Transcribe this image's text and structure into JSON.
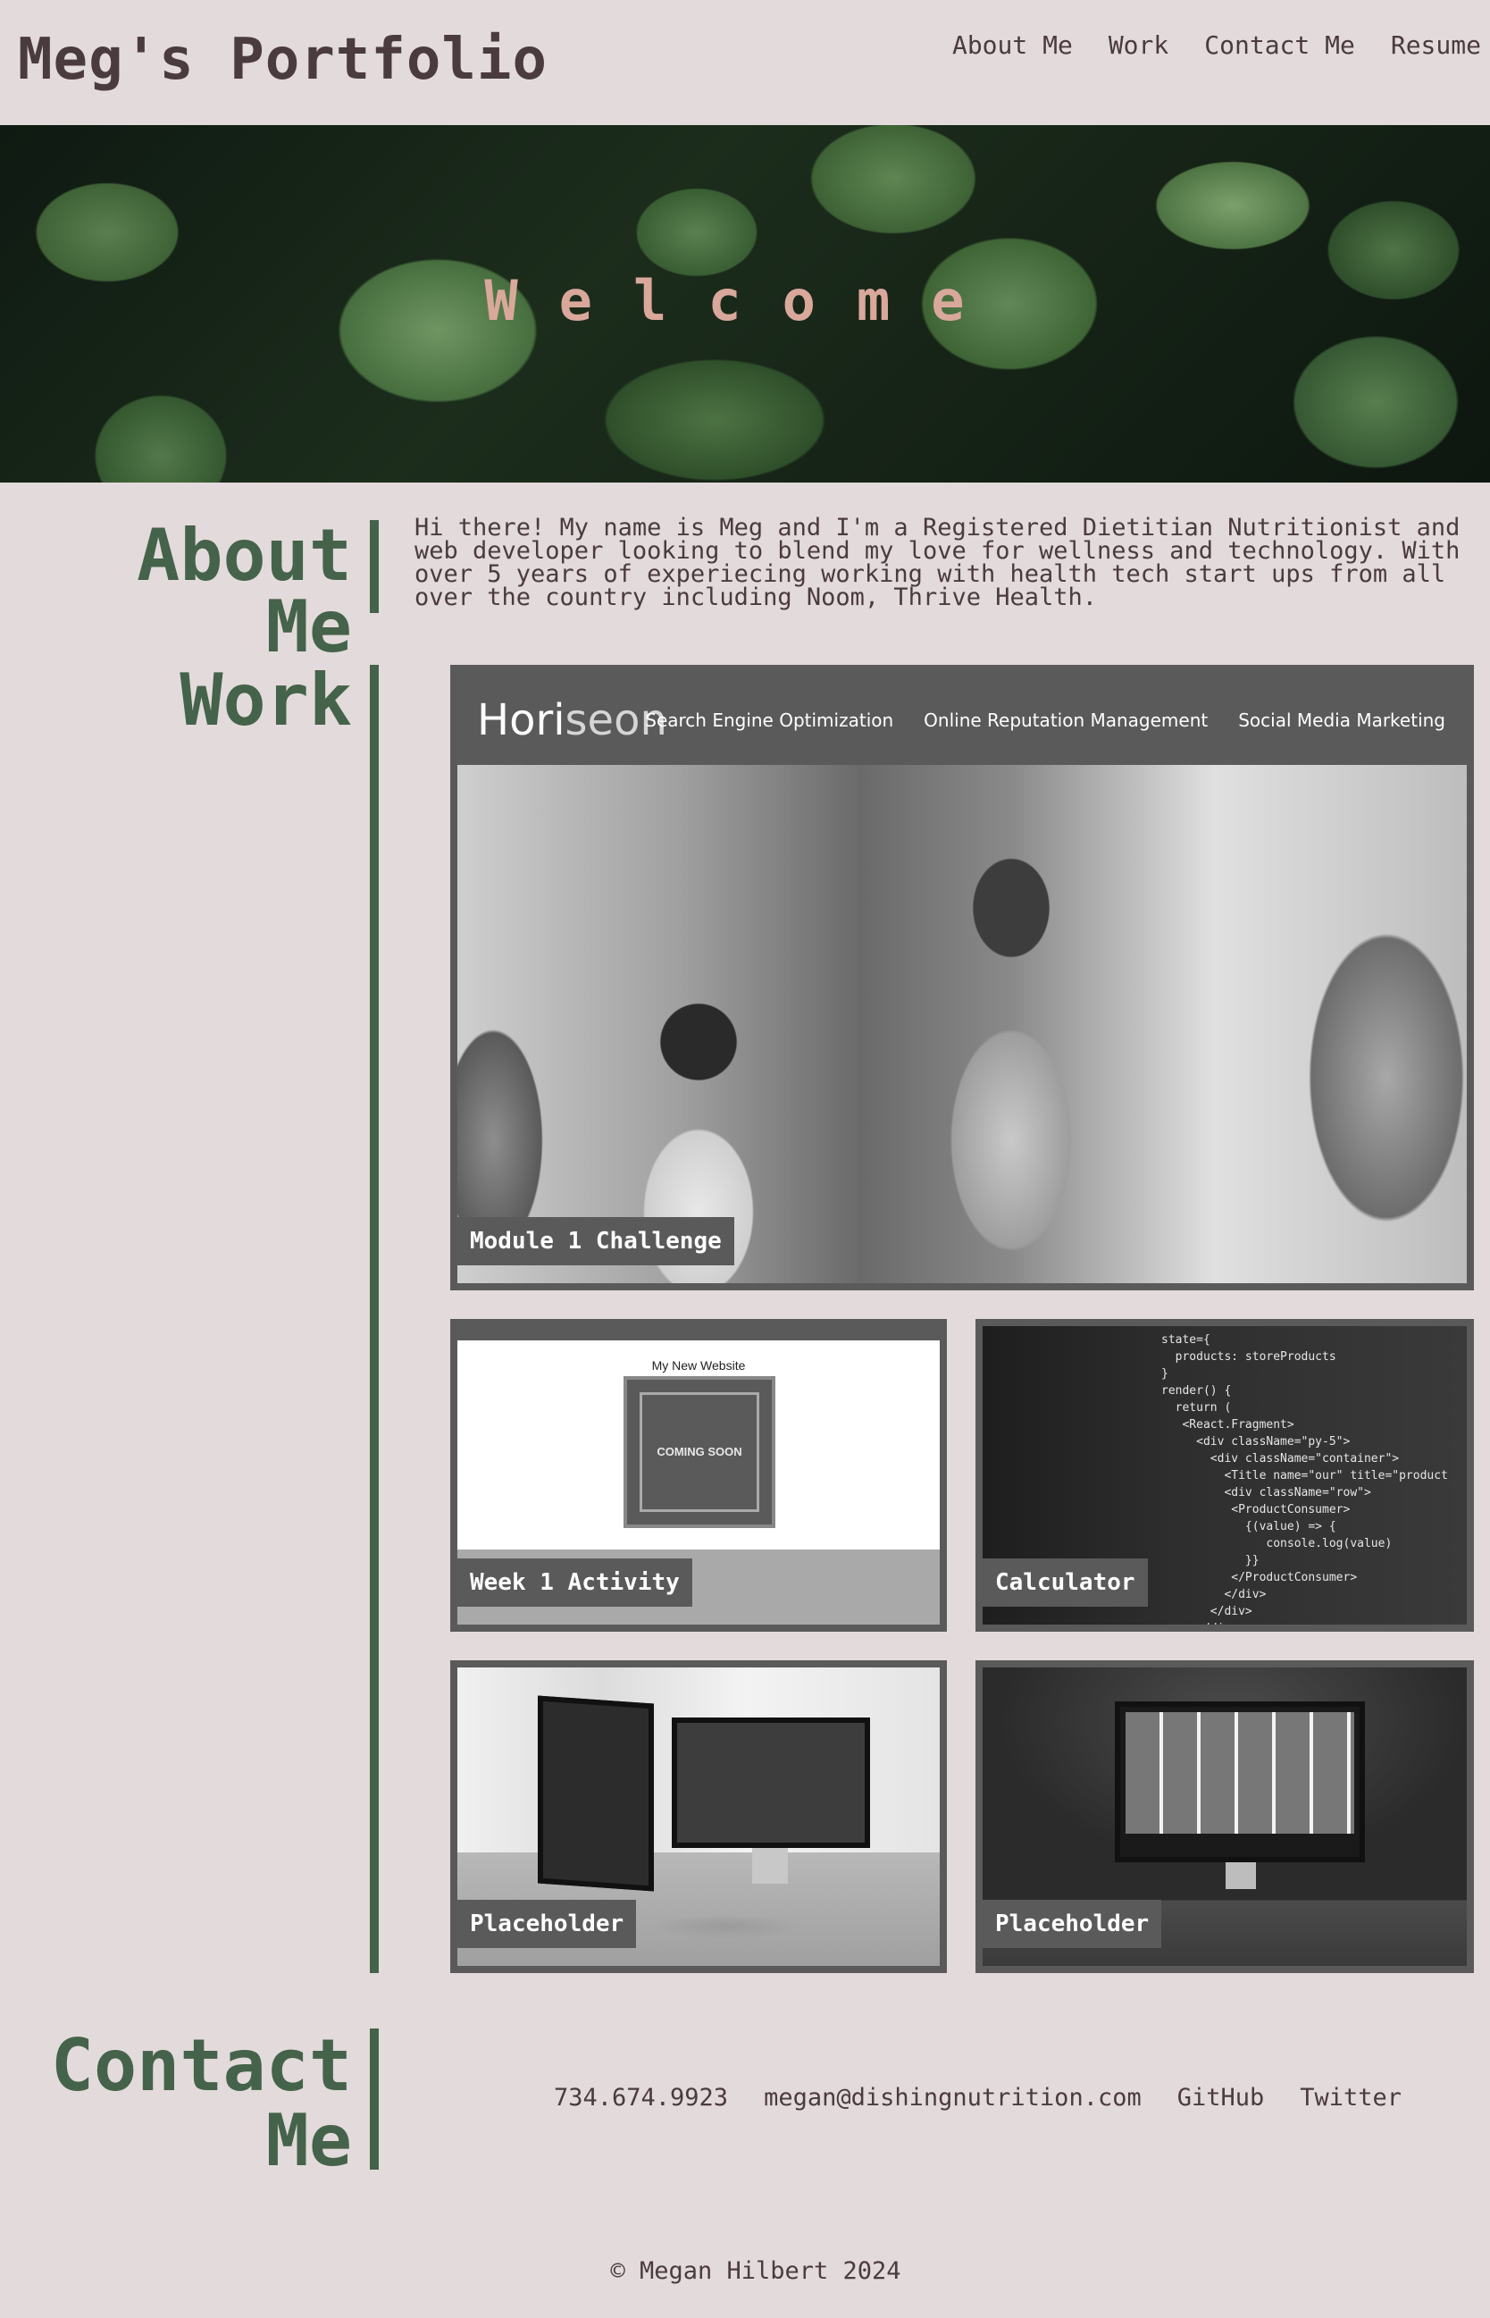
{
  "header": {
    "title": "Meg's Portfolio",
    "nav": [
      "About Me",
      "Work",
      "Contact Me",
      "Resume"
    ]
  },
  "hero": {
    "text": "Welcome"
  },
  "about": {
    "heading": "About Me",
    "text": "Hi there! My name is Meg and I'm a Registered Dietitian Nutritionist and web developer looking to blend my love for wellness and technology. With over 5 years of experiecing working with health tech start ups from all over the country including Noom, Thrive Health."
  },
  "work": {
    "heading": "Work",
    "projects": [
      {
        "label": "Module 1 Challenge",
        "preview": {
          "logo_bold": "Hori",
          "logo_light": "seon",
          "nav": [
            "Search Engine Optimization",
            "Online Reputation Management",
            "Social Media Marketing"
          ]
        }
      },
      {
        "label": "Week 1 Activity",
        "preview": {
          "heading": "My New Website",
          "box_text": "COMING SOON"
        }
      },
      {
        "label": "Calculator"
      },
      {
        "label": "Placeholder"
      },
      {
        "label": "Placeholder"
      }
    ]
  },
  "contact": {
    "heading": "Contact Me",
    "links": [
      "734.674.9923",
      "megan@dishingnutrition.com",
      "GitHub",
      "Twitter"
    ]
  },
  "footer": {
    "text": "© Megan Hilbert 2024"
  },
  "colors": {
    "background": "#e3dadb",
    "accent_green": "#44634a",
    "text": "#4a3b3f",
    "hero_text": "#d9a89b",
    "card_border": "#5b5a5a"
  }
}
